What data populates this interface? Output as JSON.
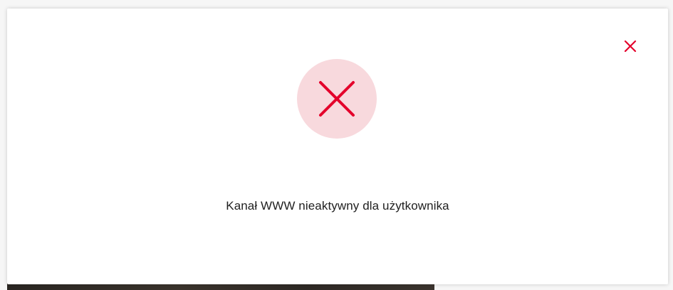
{
  "modal": {
    "message": "Kanał WWW nieaktywny dla użytkownika",
    "status": "error"
  },
  "icons": {
    "close": "close-icon",
    "status": "error-x-icon"
  },
  "colors": {
    "accent": "#e4002b",
    "status_bg": "#f8d9dd",
    "text": "#1f1f1f"
  }
}
